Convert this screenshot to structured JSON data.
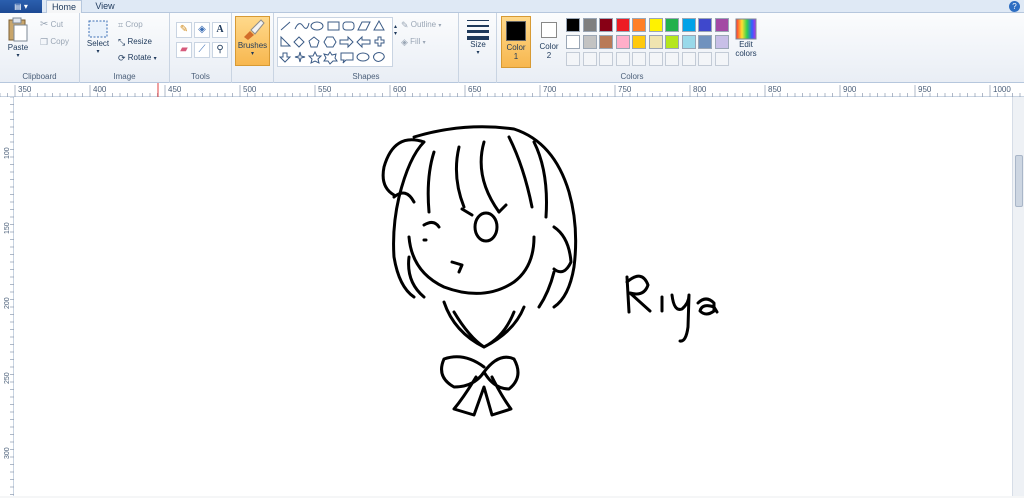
{
  "app_menu": {
    "label": "▤ ▾"
  },
  "tabs": [
    {
      "label": "Home"
    },
    {
      "label": "View"
    }
  ],
  "help": "?",
  "clipboard": {
    "label": "Clipboard",
    "paste": "Paste",
    "cut": "Cut",
    "copy": "Copy"
  },
  "image": {
    "label": "Image",
    "select": "Select",
    "crop": "Crop",
    "resize": "Resize",
    "rotate": "Rotate"
  },
  "tools": {
    "label": "Tools"
  },
  "brushes": {
    "label": "Brushes"
  },
  "shapes": {
    "label": "Shapes",
    "outline": "Outline",
    "fill": "Fill"
  },
  "size": {
    "label": "Size"
  },
  "colors": {
    "label": "Colors",
    "color1_label": "Color",
    "color1_num": "1",
    "color2_label": "Color",
    "color2_num": "2",
    "edit_label_1": "Edit",
    "edit_label_2": "colors",
    "color1": "#000000",
    "color2": "#ffffff",
    "row1": [
      "#000000",
      "#7f7f7f",
      "#880015",
      "#ed1c24",
      "#ff7f27",
      "#fff200",
      "#22b14c",
      "#00a2e8",
      "#3f48cc",
      "#a349a4"
    ],
    "row2": [
      "#ffffff",
      "#c3c3c3",
      "#b97a57",
      "#ffaec9",
      "#ffc90e",
      "#efe4b0",
      "#b5e61d",
      "#99d9ea",
      "#7092be",
      "#c8bfe7"
    ]
  },
  "ruler_h": [
    "350",
    "400",
    "450",
    "500",
    "550",
    "600",
    "650",
    "700",
    "750",
    "800",
    "850",
    "900",
    "950",
    "1000"
  ],
  "ruler_v": [
    "100",
    "150",
    "200",
    "250",
    "300"
  ],
  "drawing": {
    "signature": "Riya"
  }
}
